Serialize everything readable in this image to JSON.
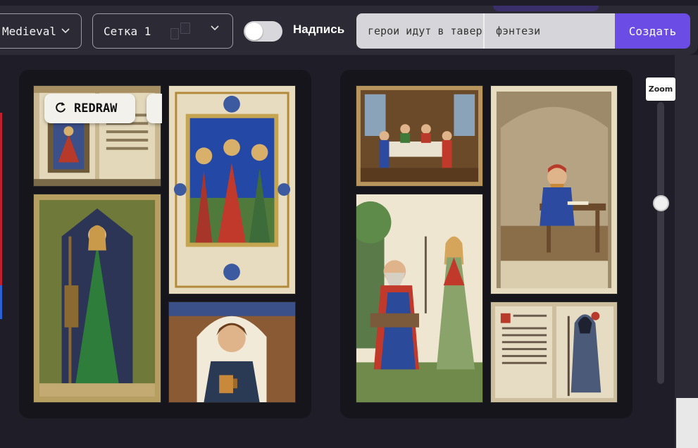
{
  "toolbar": {
    "style_value": "Medieval",
    "grid_value": "Сетка 1",
    "caption_label": "Надпись",
    "caption_toggle_on": false,
    "prompt_value": "герои идут в таверну",
    "genre_value": "фэнтези",
    "create_label": "Создать",
    "accent_color": "#6b4de6"
  },
  "grid1": {
    "redraw_label": "REDRAW",
    "images": [
      {
        "name": "illuminated-book-angel"
      },
      {
        "name": "three-saints-manuscript"
      },
      {
        "name": "lady-in-green-dress"
      },
      {
        "name": "man-with-mug"
      }
    ]
  },
  "grid2": {
    "images": [
      {
        "name": "tavern-feast-scene"
      },
      {
        "name": "scribe-in-cellar"
      },
      {
        "name": "wizard-and-elf-maiden"
      },
      {
        "name": "hooded-figure-manuscript"
      }
    ]
  },
  "zoom": {
    "label": "Zoom",
    "level": 0.65
  },
  "icons": {
    "style_chevron": "chevron-down-icon",
    "grid_chevron": "chevron-down-icon",
    "redraw": "refresh-icon"
  }
}
